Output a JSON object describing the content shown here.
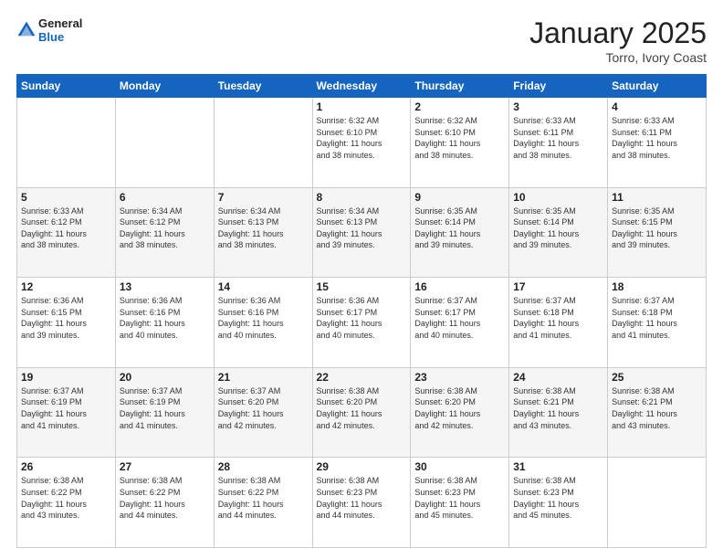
{
  "header": {
    "logo_general": "General",
    "logo_blue": "Blue",
    "month": "January 2025",
    "location": "Torro, Ivory Coast"
  },
  "days_of_week": [
    "Sunday",
    "Monday",
    "Tuesday",
    "Wednesday",
    "Thursday",
    "Friday",
    "Saturday"
  ],
  "weeks": [
    [
      {
        "day": "",
        "info": ""
      },
      {
        "day": "",
        "info": ""
      },
      {
        "day": "",
        "info": ""
      },
      {
        "day": "1",
        "info": "Sunrise: 6:32 AM\nSunset: 6:10 PM\nDaylight: 11 hours\nand 38 minutes."
      },
      {
        "day": "2",
        "info": "Sunrise: 6:32 AM\nSunset: 6:10 PM\nDaylight: 11 hours\nand 38 minutes."
      },
      {
        "day": "3",
        "info": "Sunrise: 6:33 AM\nSunset: 6:11 PM\nDaylight: 11 hours\nand 38 minutes."
      },
      {
        "day": "4",
        "info": "Sunrise: 6:33 AM\nSunset: 6:11 PM\nDaylight: 11 hours\nand 38 minutes."
      }
    ],
    [
      {
        "day": "5",
        "info": "Sunrise: 6:33 AM\nSunset: 6:12 PM\nDaylight: 11 hours\nand 38 minutes."
      },
      {
        "day": "6",
        "info": "Sunrise: 6:34 AM\nSunset: 6:12 PM\nDaylight: 11 hours\nand 38 minutes."
      },
      {
        "day": "7",
        "info": "Sunrise: 6:34 AM\nSunset: 6:13 PM\nDaylight: 11 hours\nand 38 minutes."
      },
      {
        "day": "8",
        "info": "Sunrise: 6:34 AM\nSunset: 6:13 PM\nDaylight: 11 hours\nand 39 minutes."
      },
      {
        "day": "9",
        "info": "Sunrise: 6:35 AM\nSunset: 6:14 PM\nDaylight: 11 hours\nand 39 minutes."
      },
      {
        "day": "10",
        "info": "Sunrise: 6:35 AM\nSunset: 6:14 PM\nDaylight: 11 hours\nand 39 minutes."
      },
      {
        "day": "11",
        "info": "Sunrise: 6:35 AM\nSunset: 6:15 PM\nDaylight: 11 hours\nand 39 minutes."
      }
    ],
    [
      {
        "day": "12",
        "info": "Sunrise: 6:36 AM\nSunset: 6:15 PM\nDaylight: 11 hours\nand 39 minutes."
      },
      {
        "day": "13",
        "info": "Sunrise: 6:36 AM\nSunset: 6:16 PM\nDaylight: 11 hours\nand 40 minutes."
      },
      {
        "day": "14",
        "info": "Sunrise: 6:36 AM\nSunset: 6:16 PM\nDaylight: 11 hours\nand 40 minutes."
      },
      {
        "day": "15",
        "info": "Sunrise: 6:36 AM\nSunset: 6:17 PM\nDaylight: 11 hours\nand 40 minutes."
      },
      {
        "day": "16",
        "info": "Sunrise: 6:37 AM\nSunset: 6:17 PM\nDaylight: 11 hours\nand 40 minutes."
      },
      {
        "day": "17",
        "info": "Sunrise: 6:37 AM\nSunset: 6:18 PM\nDaylight: 11 hours\nand 41 minutes."
      },
      {
        "day": "18",
        "info": "Sunrise: 6:37 AM\nSunset: 6:18 PM\nDaylight: 11 hours\nand 41 minutes."
      }
    ],
    [
      {
        "day": "19",
        "info": "Sunrise: 6:37 AM\nSunset: 6:19 PM\nDaylight: 11 hours\nand 41 minutes."
      },
      {
        "day": "20",
        "info": "Sunrise: 6:37 AM\nSunset: 6:19 PM\nDaylight: 11 hours\nand 41 minutes."
      },
      {
        "day": "21",
        "info": "Sunrise: 6:37 AM\nSunset: 6:20 PM\nDaylight: 11 hours\nand 42 minutes."
      },
      {
        "day": "22",
        "info": "Sunrise: 6:38 AM\nSunset: 6:20 PM\nDaylight: 11 hours\nand 42 minutes."
      },
      {
        "day": "23",
        "info": "Sunrise: 6:38 AM\nSunset: 6:20 PM\nDaylight: 11 hours\nand 42 minutes."
      },
      {
        "day": "24",
        "info": "Sunrise: 6:38 AM\nSunset: 6:21 PM\nDaylight: 11 hours\nand 43 minutes."
      },
      {
        "day": "25",
        "info": "Sunrise: 6:38 AM\nSunset: 6:21 PM\nDaylight: 11 hours\nand 43 minutes."
      }
    ],
    [
      {
        "day": "26",
        "info": "Sunrise: 6:38 AM\nSunset: 6:22 PM\nDaylight: 11 hours\nand 43 minutes."
      },
      {
        "day": "27",
        "info": "Sunrise: 6:38 AM\nSunset: 6:22 PM\nDaylight: 11 hours\nand 44 minutes."
      },
      {
        "day": "28",
        "info": "Sunrise: 6:38 AM\nSunset: 6:22 PM\nDaylight: 11 hours\nand 44 minutes."
      },
      {
        "day": "29",
        "info": "Sunrise: 6:38 AM\nSunset: 6:23 PM\nDaylight: 11 hours\nand 44 minutes."
      },
      {
        "day": "30",
        "info": "Sunrise: 6:38 AM\nSunset: 6:23 PM\nDaylight: 11 hours\nand 45 minutes."
      },
      {
        "day": "31",
        "info": "Sunrise: 6:38 AM\nSunset: 6:23 PM\nDaylight: 11 hours\nand 45 minutes."
      },
      {
        "day": "",
        "info": ""
      }
    ]
  ]
}
